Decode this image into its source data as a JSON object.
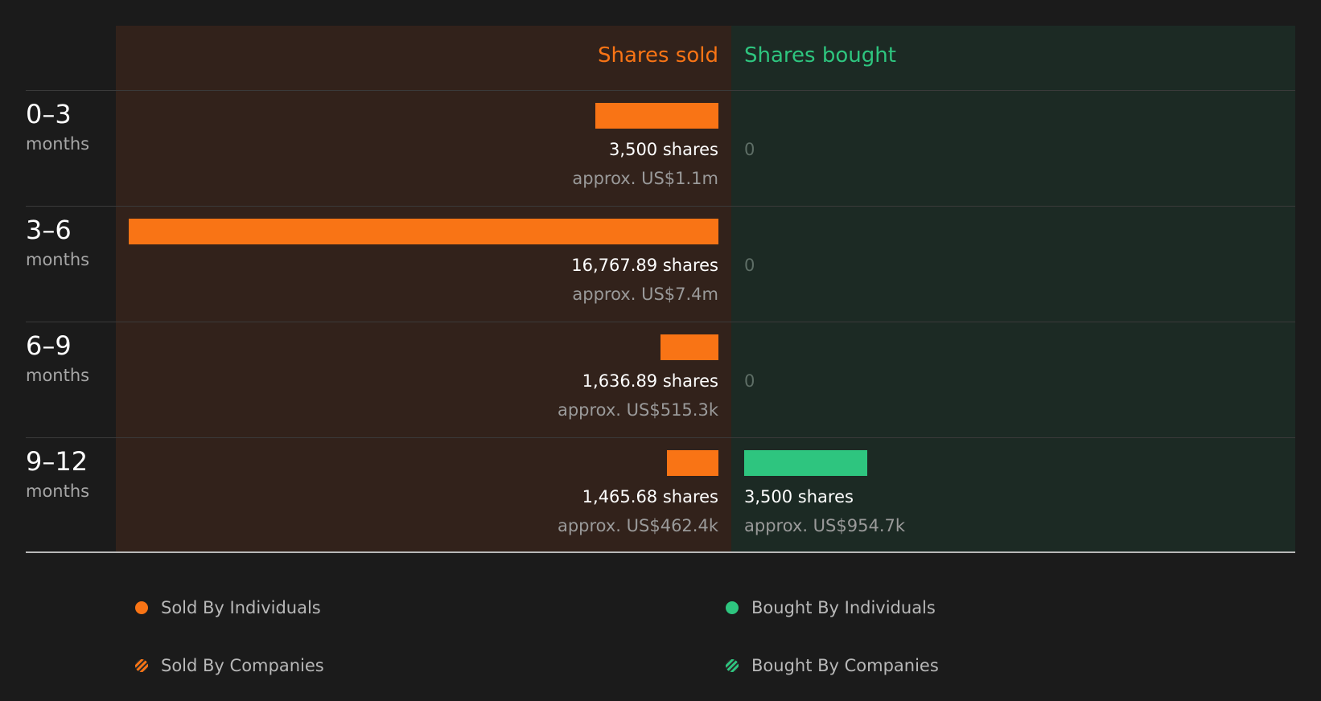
{
  "chart_data": {
    "type": "bar",
    "headers": {
      "sold": "Shares sold",
      "bought": "Shares bought"
    },
    "unit_label": "months",
    "categories": [
      "0–3",
      "3–6",
      "6–9",
      "9–12"
    ],
    "series": [
      {
        "name": "Shares sold",
        "values": [
          3500,
          16767.89,
          1636.89,
          1465.68
        ]
      },
      {
        "name": "Shares bought",
        "values": [
          0,
          0,
          0,
          3500
        ]
      }
    ],
    "rows": [
      {
        "range": "0–3",
        "unit": "months",
        "sold_shares": "3,500 shares",
        "sold_value": "approx. US$1.1m",
        "bought_shares": "0",
        "bought_value": ""
      },
      {
        "range": "3–6",
        "unit": "months",
        "sold_shares": "16,767.89 shares",
        "sold_value": "approx. US$7.4m",
        "bought_shares": "0",
        "bought_value": ""
      },
      {
        "range": "6–9",
        "unit": "months",
        "sold_shares": "1,636.89 shares",
        "sold_value": "approx. US$515.3k",
        "bought_shares": "0",
        "bought_value": ""
      },
      {
        "range": "9–12",
        "unit": "months",
        "sold_shares": "1,465.68 shares",
        "sold_value": "approx. US$462.4k",
        "bought_shares": "3,500 shares",
        "bought_value": "approx. US$954.7k"
      }
    ],
    "legend": [
      {
        "label": "Sold By Individuals",
        "style": "solid-orange"
      },
      {
        "label": "Bought By Individuals",
        "style": "solid-green"
      },
      {
        "label": "Sold By Companies",
        "style": "hatched-orange"
      },
      {
        "label": "Bought By Companies",
        "style": "hatched-green"
      }
    ],
    "colors": {
      "sold": "#f97415",
      "bought": "#2ec57f",
      "sold_bg": "#32221b",
      "bought_bg": "#1c2a24",
      "background": "#1b1b1b"
    }
  }
}
